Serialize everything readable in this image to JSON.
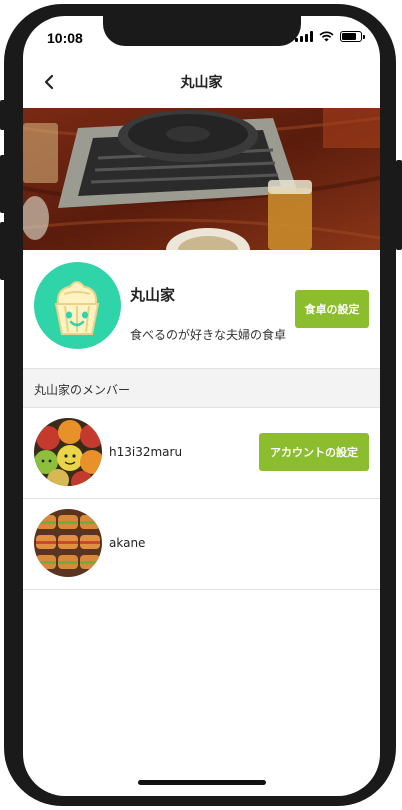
{
  "status_bar": {
    "time": "10:08",
    "battery_level": 0.85
  },
  "nav": {
    "title": "丸山家",
    "back_icon": "chevron-left-icon"
  },
  "group": {
    "name": "丸山家",
    "description": "食べるのが好きな夫婦の食卓",
    "settings_label": "食卓の設定",
    "avatar_icon": "cupcake-face-icon"
  },
  "members_section": {
    "title": "丸山家のメンバー"
  },
  "members": [
    {
      "name": "h13i32maru",
      "account_settings_label": "アカウントの設定"
    },
    {
      "name": "akane"
    }
  ],
  "colors": {
    "accent_green": "#8bbd2e",
    "avatar_teal": "#2fd5a8",
    "section_bg": "#f3f3f3"
  }
}
